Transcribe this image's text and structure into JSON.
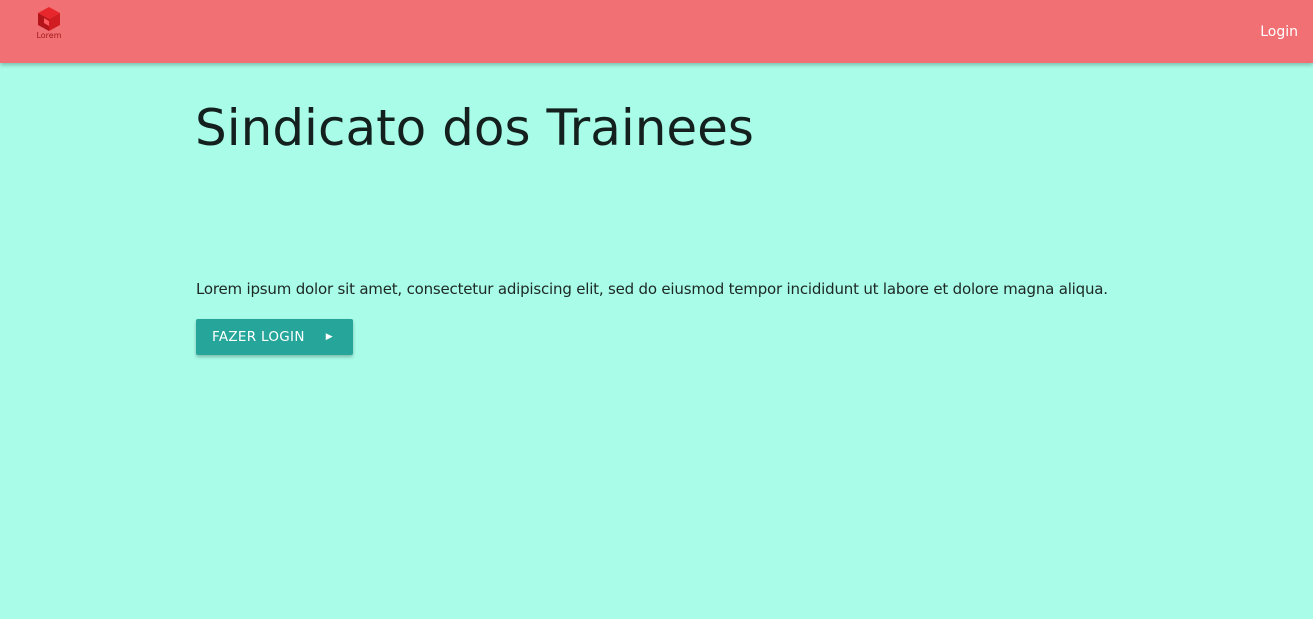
{
  "header": {
    "logo_text": "Lorem",
    "login_link": "Login",
    "background_color": "#f07074"
  },
  "main": {
    "title": "Sindicato dos Trainees",
    "intro": "Lorem ipsum dolor sit amet, consectetur adipiscing elit, sed do eiusmod tempor incididunt ut labore et dolore magna aliqua.",
    "cta_label": "FAZER LOGIN",
    "cta_icon": "arrow-right-icon",
    "background_color": "#a8fce8",
    "button_color": "#26a69a"
  }
}
